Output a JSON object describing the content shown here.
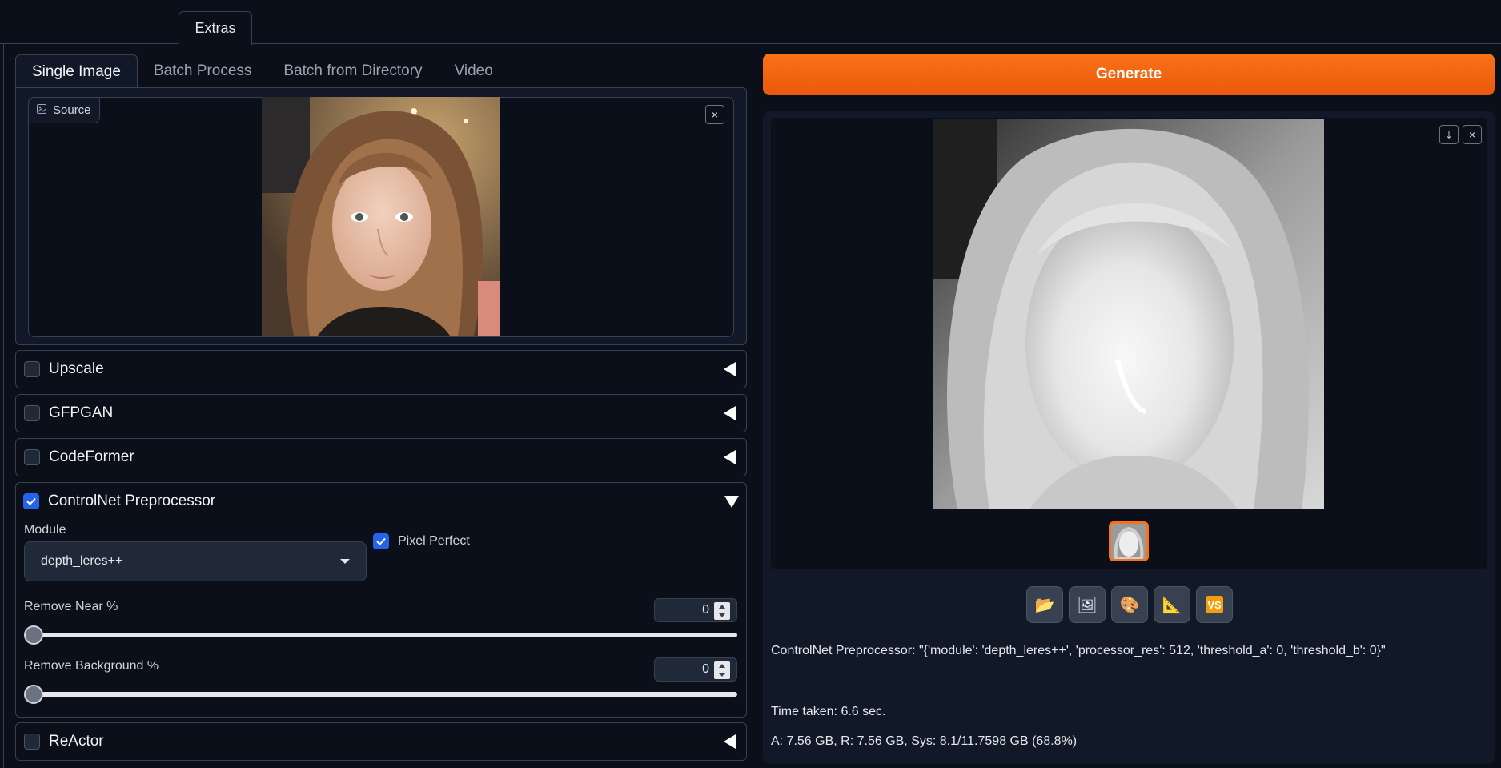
{
  "top_tabs": [
    {
      "label": "Extras"
    }
  ],
  "subtabs": [
    {
      "label": "Single Image"
    },
    {
      "label": "Batch Process"
    },
    {
      "label": "Batch from Directory"
    },
    {
      "label": "Video"
    }
  ],
  "source": {
    "label": "Source",
    "close_icon": "×"
  },
  "accordions": {
    "upscale": {
      "title": "Upscale",
      "checked": false
    },
    "gfpgan": {
      "title": "GFPGAN",
      "checked": false
    },
    "codeformer": {
      "title": "CodeFormer",
      "checked": false
    },
    "controlnet": {
      "title": "ControlNet Preprocessor",
      "checked": true
    },
    "reactor": {
      "title": "ReActor",
      "checked": false
    }
  },
  "controlnet": {
    "module_label": "Module",
    "module_value": "depth_leres++",
    "pixel_perfect_label": "Pixel Perfect",
    "pixel_perfect_checked": true,
    "remove_near_label": "Remove Near %",
    "remove_near_value": "0",
    "remove_bg_label": "Remove Background %",
    "remove_bg_value": "0"
  },
  "generate_label": "Generate",
  "output": {
    "download_icon": "⤓",
    "close_icon": "×",
    "tools": [
      {
        "name": "folder-icon",
        "glyph": "📂"
      },
      {
        "name": "image-icon",
        "glyph": "🖼"
      },
      {
        "name": "palette-icon",
        "glyph": "🎨"
      },
      {
        "name": "ruler-icon",
        "glyph": "📐"
      },
      {
        "name": "vs-icon",
        "glyph": "VS"
      }
    ],
    "info_line": "ControlNet Preprocessor: \"{'module': 'depth_leres++', 'processor_res': 512, 'threshold_a': 0, 'threshold_b': 0}\"",
    "time_taken": "Time taken: 6.6 sec.",
    "memory": "A: 7.56 GB, R: 7.56 GB, Sys: 8.1/11.7598 GB (68.8%)"
  },
  "colors": {
    "accent": "#f97316",
    "checkbox": "#2563eb",
    "background": "#0b0f19"
  }
}
